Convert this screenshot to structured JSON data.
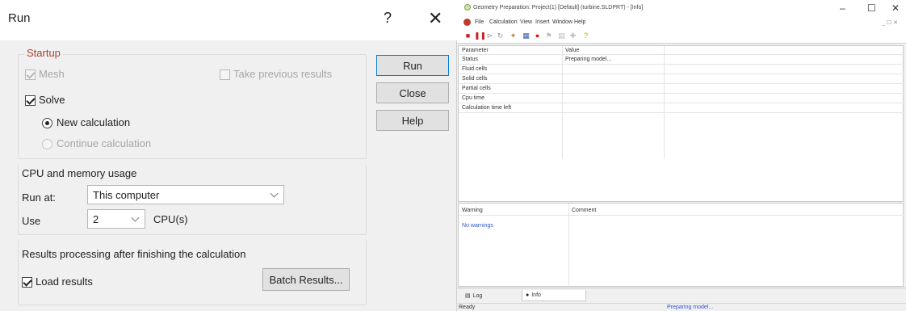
{
  "dialog": {
    "title": "Run",
    "help_glyph": "?",
    "close_glyph": "✕",
    "startup": {
      "legend": "Startup",
      "mesh": {
        "label": "Mesh",
        "checked": true,
        "enabled": false
      },
      "take_previous": {
        "label": "Take previous results",
        "checked": false,
        "enabled": false
      },
      "solve": {
        "label": "Solve",
        "checked": true,
        "enabled": true
      },
      "new_calculation": {
        "label": "New calculation",
        "selected": true
      },
      "continue_calculation": {
        "label": "Continue calculation",
        "selected": false,
        "enabled": false
      }
    },
    "cpu": {
      "legend": "CPU and memory usage",
      "run_at_label": "Run at:",
      "run_at_value": "This computer",
      "use_label": "Use",
      "use_value": "2",
      "cpu_unit": "CPU(s)"
    },
    "results": {
      "legend": "Results processing after finishing the calculation",
      "load_results": {
        "label": "Load results",
        "checked": true
      },
      "batch_button": "Batch Results..."
    },
    "buttons": {
      "run": "Run",
      "close": "Close",
      "help": "Help"
    }
  },
  "info_window": {
    "title": "Geometry Preparation: Project(1) [Default] (turbine.SLDPRT) - [Info]",
    "window_controls": {
      "minimize": "–",
      "restore": "☐",
      "close": "✕"
    },
    "menu": [
      "File",
      "Calculation",
      "View",
      "Insert",
      "Window",
      "Help"
    ],
    "mdi_controls": "_ ☐ ✕",
    "table": {
      "headers": [
        "Parameter",
        "Value"
      ],
      "rows": [
        [
          "Status",
          "Preparing model..."
        ],
        [
          "Fluid cells",
          ""
        ],
        [
          "Solid cells",
          ""
        ],
        [
          "Partial cells",
          ""
        ],
        [
          "Cpu time",
          ""
        ],
        [
          "Calculation time left",
          ""
        ]
      ]
    },
    "warnings": {
      "headers": [
        "Warning",
        "Comment"
      ],
      "rows": [
        [
          "No warnings",
          ""
        ]
      ]
    },
    "tabs": {
      "log": "Log",
      "info": "Info"
    },
    "status_left": "Ready",
    "status_right": "Preparing model..."
  },
  "colors": {
    "accent_border": "#0078d7",
    "stop_red": "#cc1f1f",
    "link_blue": "#3355cc"
  }
}
